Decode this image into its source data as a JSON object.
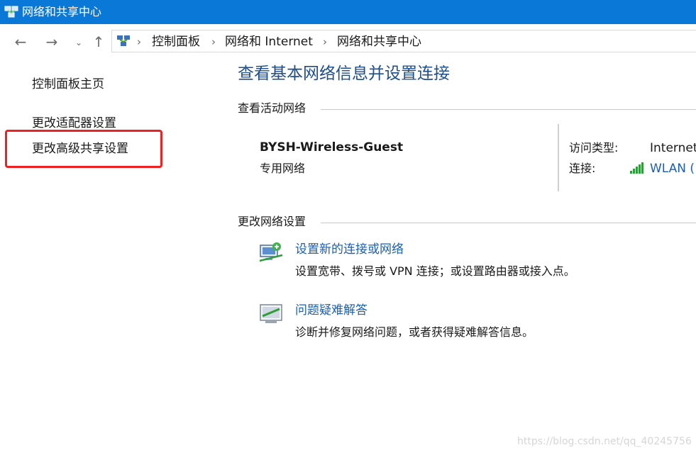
{
  "window": {
    "title": "网络和共享中心"
  },
  "nav": {
    "back": "←",
    "forward": "→",
    "recent": "⌄",
    "up": "↑"
  },
  "breadcrumb": [
    "控制面板",
    "网络和 Internet",
    "网络和共享中心"
  ],
  "sidebar": {
    "home": "控制面板主页",
    "adapter": "更改适配器设置",
    "advanced_sharing": "更改高级共享设置"
  },
  "main": {
    "title": "查看基本网络信息并设置连接",
    "active_networks_heading": "查看活动网络",
    "network": {
      "name": "BYSH-Wireless-Guest",
      "type": "专用网络",
      "access_type_label": "访问类型:",
      "access_type_value": "Internet",
      "connections_label": "连接:",
      "connections_value": "WLAN ("
    },
    "change_settings_heading": "更改网络设置",
    "tasks": [
      {
        "link": "设置新的连接或网络",
        "desc": "设置宽带、拨号或 VPN 连接；或设置路由器或接入点。"
      },
      {
        "link": "问题疑难解答",
        "desc": "诊断并修复网络问题，或者获得疑难解答信息。"
      }
    ]
  },
  "watermark": "https://blog.csdn.net/qq_40245756",
  "colors": {
    "titlebar": "#0a78d7",
    "link": "#1a5fb4",
    "title": "#1e4e8c",
    "highlight": "#ee2222"
  }
}
